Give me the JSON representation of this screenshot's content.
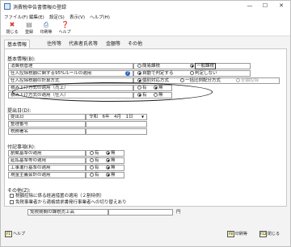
{
  "window": {
    "title": "消費税申告書情報の登録",
    "controls": [
      "—",
      "☐",
      "✕"
    ]
  },
  "menu": [
    "ファイル(F)",
    "編集(E)",
    "設定(S)",
    "表示(V)",
    "ヘルプ(H)"
  ],
  "toolbar": [
    {
      "label": "閉じる",
      "icon": "close-icon"
    },
    {
      "label": "登録",
      "icon": "register-icon"
    },
    {
      "label": "印刷等",
      "icon": "print-icon"
    },
    {
      "label": "ヘルプ",
      "icon": "help-icon"
    }
  ],
  "tabs": [
    "基本情報",
    "住所等",
    "代表者氏名等",
    "金額等",
    "その他"
  ],
  "basic": {
    "title": "基本情報(B):",
    "rows": [
      {
        "label": "消費税管理",
        "options": [
          "簡易課税",
          "一般課税"
        ],
        "selected": 1
      },
      {
        "label": "仕入控除税額に関する95%ルールの適用",
        "help": "?",
        "options": [
          "自動で判定する",
          "判定しない"
        ],
        "selected": 0
      },
      {
        "label": "仕入控除税額の計算方式",
        "options": [
          "個別対応方式",
          "一括比例配分方式",
          "全額控除"
        ],
        "selected": 0
      },
      {
        "label": "積み上げ方式の適用（売上）",
        "options": [
          "有",
          "無"
        ],
        "selected": 1
      },
      {
        "label": "積み上げ方式の適用（仕入）",
        "options": [
          "有",
          "無"
        ],
        "selected": 0
      }
    ]
  },
  "submit": {
    "title": "提出日(D):",
    "rows": [
      {
        "label": "提出日",
        "value": "令和　6年　4月　1日"
      },
      {
        "label": "整理番号",
        "value": ""
      },
      {
        "label": "税務署名",
        "value": ""
      }
    ],
    "calendar_label": "▼"
  },
  "notes": {
    "title": "付記事項(R):",
    "rows": [
      {
        "label": "割賦基準の適用",
        "options": [
          "有",
          "無"
        ],
        "selected": 1
      },
      {
        "label": "延払基準等の適用",
        "options": [
          "有",
          "無"
        ],
        "selected": 1
      },
      {
        "label": "工事進行基準の適用",
        "options": [
          "有",
          "無"
        ],
        "selected": 1
      },
      {
        "label": "現金主義会計の適用",
        "options": [
          "有",
          "無"
        ],
        "selected": 1
      }
    ]
  },
  "other": {
    "title": "その他(Z):",
    "checks": [
      "税額控除に係る経過措置の適用（２割特例）",
      "免税事業者から適格請求書発行事業者への切り替えあり"
    ],
    "amount_label": "免税期間の課税売上高",
    "amount_value": "",
    "amount_unit": "円"
  },
  "statusbar": {
    "left": {
      "key": "F1",
      "label": "ヘルプ"
    },
    "right": [
      {
        "key": "F8",
        "label": "印刷等"
      },
      {
        "key": "F12",
        "label": "閉じる"
      }
    ]
  }
}
